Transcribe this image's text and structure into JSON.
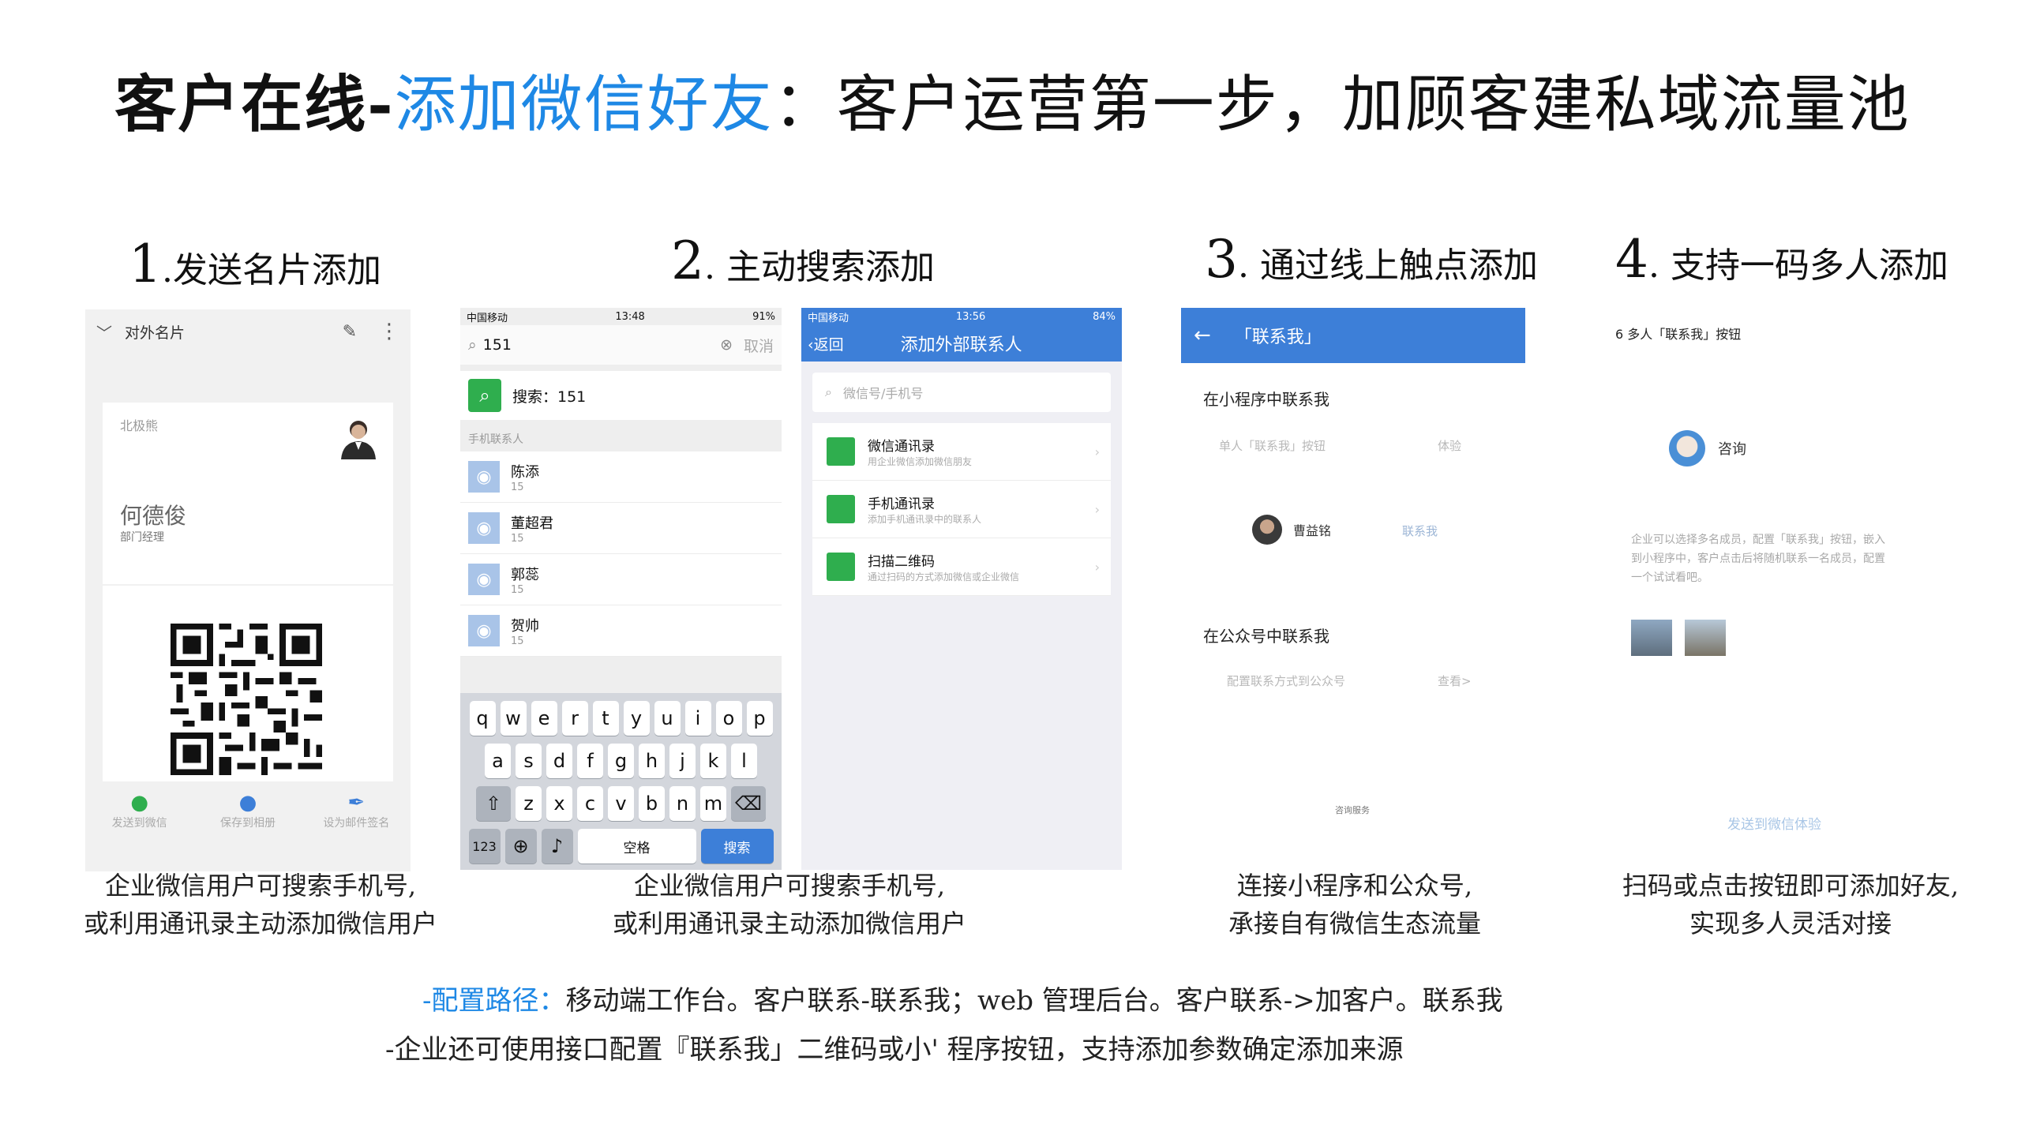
{
  "title": {
    "part1": "客户在线-",
    "part2": "添加微信好友",
    "part3": "：客户运营第一步，加顾客建私域流量池"
  },
  "steps": [
    {
      "num": "1",
      "label": ".发送名片添加"
    },
    {
      "num": "2",
      "label": ". 主动搜索添加"
    },
    {
      "num": "3",
      "label": ". 通过线上触点添加"
    },
    {
      "num": "4",
      "label": ". 支持一码多人添加"
    }
  ],
  "captions": {
    "c1": [
      "企业微信用户可搜索手机号,",
      "或利用通讯录主动添加微信用户"
    ],
    "c2": [
      "企业微信用户可搜索手机号,",
      "或利用通讯录主动添加微信用户"
    ],
    "c3": [
      "连接小程序和公众号,",
      "承接自有微信生态流量"
    ],
    "c4": [
      "扫码或点击按钮即可添加好友,",
      "实现多人灵活对接"
    ]
  },
  "config": {
    "line1_prefix": "-配置路径：",
    "line1_rest": "移动端工作台。客户联系-联系我；web 管理后台。客户联系->加客户。联系我",
    "line2": "-企业还可使用接口配置『联系我」二维码或小' 程序按钮，支持添加参数确定添加来源"
  },
  "panel1": {
    "top_title": "对外名片",
    "company": "北极熊",
    "name": "何德俊",
    "role": "部门经理",
    "actions": [
      "发送到微信",
      "保存到相册",
      "设为邮件签名"
    ]
  },
  "panel2": {
    "status_left": "中国移动",
    "status_time": "13:48",
    "status_right": "91%",
    "search_value": "151",
    "cancel": "取消",
    "search_result": "搜索：151",
    "section": "手机联系人",
    "contacts": [
      {
        "name": "陈添",
        "phone": "15"
      },
      {
        "name": "董超君",
        "phone": "15"
      },
      {
        "name": "郭蕊",
        "phone": "15"
      },
      {
        "name": "贺帅",
        "phone": "15"
      }
    ],
    "keys_row1": [
      "q",
      "w",
      "e",
      "r",
      "t",
      "y",
      "u",
      "i",
      "o",
      "p"
    ],
    "keys_row2": [
      "a",
      "s",
      "d",
      "f",
      "g",
      "h",
      "j",
      "k",
      "l"
    ],
    "keys_row3": [
      "z",
      "x",
      "c",
      "v",
      "b",
      "n",
      "m"
    ],
    "key_123": "123",
    "key_space": "空格",
    "key_search": "搜索"
  },
  "panel3": {
    "status_left": "中国移动",
    "status_time": "13:56",
    "status_right": "84%",
    "back": "返回",
    "nav_title": "添加外部联系人",
    "search_placeholder": "微信号/手机号",
    "items": [
      {
        "title": "微信通讯录",
        "sub": "用企业微信添加微信朋友"
      },
      {
        "title": "手机通讯录",
        "sub": "添加手机通讯录中的联系人"
      },
      {
        "title": "扫描二维码",
        "sub": "通过扫码的方式添加微信或企业微信"
      }
    ]
  },
  "panel4": {
    "back_arrow": "←",
    "nav_title": "「联系我」",
    "section1_title": "在小程序中联系我",
    "section1_sub": "单人「联系我」按钮",
    "section1_link": "体验",
    "person": "曹益铭",
    "contact_me": "联系我",
    "section2_title": "在公众号中联系我",
    "section2_sub": "配置联系方式到公众号",
    "section2_link": "查看>",
    "footer": "咨询服务"
  },
  "panel5": {
    "header": "6 多人「联系我」按钮",
    "consult": "咨询",
    "desc": "企业可以选择多名成员，配置「联系我」按钮，嵌入到小程序中，客户点击后将随机联系一名成员，配置一个试试看吧。",
    "send": "发送到微信体验"
  }
}
